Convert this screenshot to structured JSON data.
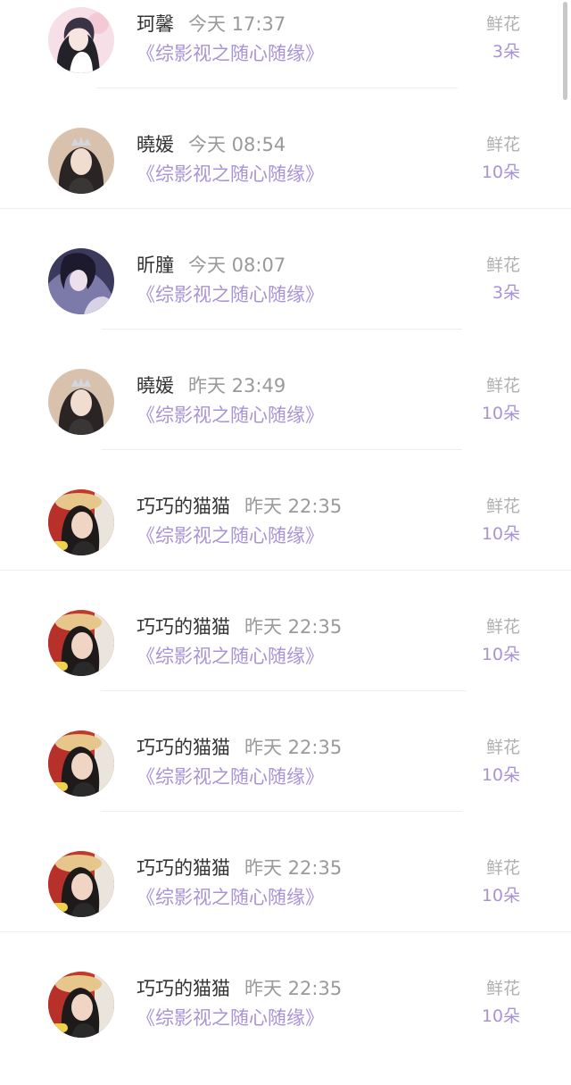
{
  "items": [
    {
      "name": "珂馨",
      "time": "今天 17:37",
      "book": "《综影视之随心随缘》",
      "gift_label": "鲜花",
      "gift_count": "3朵",
      "avatar": "avatar-anime-girl-pink"
    },
    {
      "name": "曉媛",
      "time": "今天 08:54",
      "book": "《综影视之随心随缘》",
      "gift_label": "鲜花",
      "gift_count": "10朵",
      "avatar": "avatar-girl-crown"
    },
    {
      "name": "昕朣",
      "time": "今天 08:07",
      "book": "《综影视之随心随缘》",
      "gift_label": "鲜花",
      "gift_count": "3朵",
      "avatar": "avatar-anime-girl-purple"
    },
    {
      "name": "曉媛",
      "time": "昨天 23:49",
      "book": "《综影视之随心随缘》",
      "gift_label": "鲜花",
      "gift_count": "10朵",
      "avatar": "avatar-girl-crown"
    },
    {
      "name": "巧巧的猫猫",
      "time": "昨天 22:35",
      "book": "《综影视之随心随缘》",
      "gift_label": "鲜花",
      "gift_count": "10朵",
      "avatar": "avatar-woman-hat"
    },
    {
      "name": "巧巧的猫猫",
      "time": "昨天 22:35",
      "book": "《综影视之随心随缘》",
      "gift_label": "鲜花",
      "gift_count": "10朵",
      "avatar": "avatar-woman-hat"
    },
    {
      "name": "巧巧的猫猫",
      "time": "昨天 22:35",
      "book": "《综影视之随心随缘》",
      "gift_label": "鲜花",
      "gift_count": "10朵",
      "avatar": "avatar-woman-hat"
    },
    {
      "name": "巧巧的猫猫",
      "time": "昨天 22:35",
      "book": "《综影视之随心随缘》",
      "gift_label": "鲜花",
      "gift_count": "10朵",
      "avatar": "avatar-woman-hat"
    },
    {
      "name": "巧巧的猫猫",
      "time": "昨天 22:35",
      "book": "《综影视之随心随缘》",
      "gift_label": "鲜花",
      "gift_count": "10朵",
      "avatar": "avatar-woman-hat"
    }
  ],
  "colors": {
    "accent": "#a993d6",
    "name_text": "#333333",
    "muted_text": "#9a9a9a",
    "divider": "#eeeeee"
  }
}
